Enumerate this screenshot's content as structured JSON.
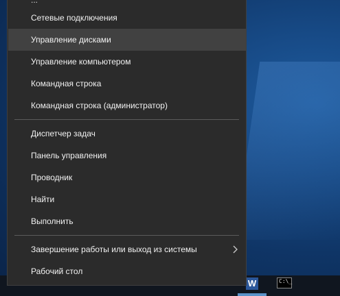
{
  "menu": {
    "cut_off_top_label": "...",
    "items": [
      {
        "label": "Сетевые подключения"
      },
      {
        "label": "Управление дисками"
      },
      {
        "label": "Управление компьютером"
      },
      {
        "label": "Командная строка"
      },
      {
        "label": "Командная строка (администратор)"
      },
      {
        "label": "Диспетчер задач"
      },
      {
        "label": "Панель управления"
      },
      {
        "label": "Проводник"
      },
      {
        "label": "Найти"
      },
      {
        "label": "Выполнить"
      },
      {
        "label": "Завершение работы или выход из системы"
      },
      {
        "label": "Рабочий стол"
      }
    ],
    "hovered_item": "Управление дисками",
    "submenu_icon": "chevron-right-icon"
  },
  "taskbar": {
    "word_icon_glyph": "W",
    "cmd_icon_glyph": "C:\\_"
  },
  "colors": {
    "menu_bg": "#2b2b2b",
    "hover_bg": "#414141",
    "text": "#f2f2f2",
    "separator": "#5c5c5c",
    "taskbar_bg": "#10161f",
    "active_indicator": "#5a93c8"
  }
}
